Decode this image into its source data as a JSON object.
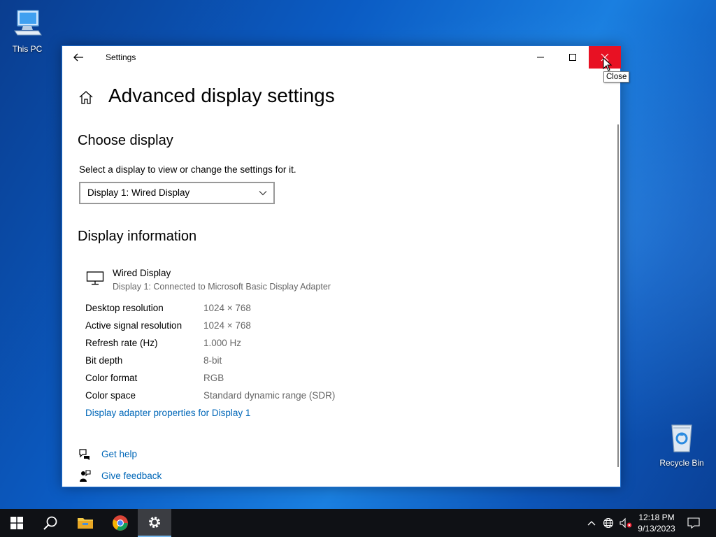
{
  "desktop": {
    "icons": [
      {
        "label": "This PC",
        "icon": "computer-icon"
      },
      {
        "label": "Recycle Bin",
        "icon": "recycle-bin-icon"
      }
    ]
  },
  "window": {
    "title": "Settings",
    "page_title": "Advanced display settings",
    "choose_display": {
      "heading": "Choose display",
      "description": "Select a display to view or change the settings for it.",
      "selected": "Display 1: Wired Display"
    },
    "display_info": {
      "heading": "Display information",
      "name": "Wired Display",
      "subtitle": "Display 1: Connected to Microsoft Basic Display Adapter",
      "rows": [
        {
          "label": "Desktop resolution",
          "value": "1024 × 768"
        },
        {
          "label": "Active signal resolution",
          "value": "1024 × 768"
        },
        {
          "label": "Refresh rate (Hz)",
          "value": "1.000 Hz"
        },
        {
          "label": "Bit depth",
          "value": "8-bit"
        },
        {
          "label": "Color format",
          "value": "RGB"
        },
        {
          "label": "Color space",
          "value": "Standard dynamic range (SDR)"
        }
      ],
      "adapter_link": "Display adapter properties for Display 1"
    },
    "help": {
      "get_help": "Get help",
      "give_feedback": "Give feedback"
    },
    "tooltip": "Close"
  },
  "taskbar": {
    "clock_time": "12:18 PM",
    "clock_date": "9/13/2023"
  },
  "colors": {
    "accent_link": "#0067b8",
    "close_red": "#e81123",
    "taskbar": "#0f1115"
  }
}
